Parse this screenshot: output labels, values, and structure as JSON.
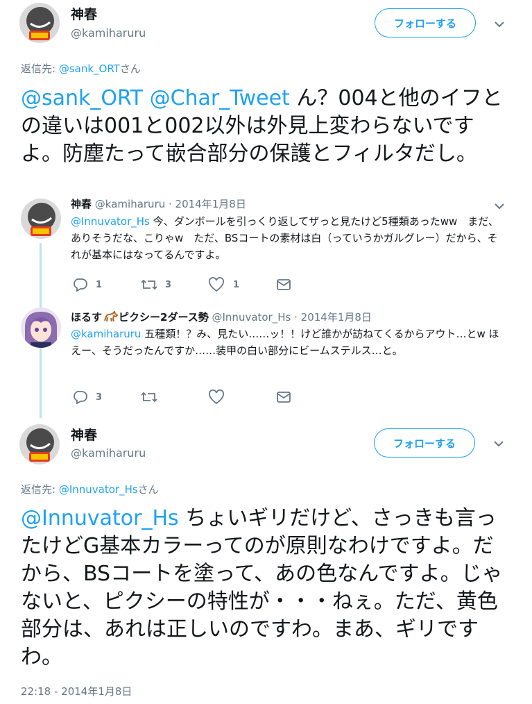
{
  "tweet1": {
    "name": "神春",
    "handle": "@kamiharuru",
    "follow_label": "フォローする",
    "reply_prefix": "返信先: ",
    "reply_to": "@sank_ORT",
    "reply_suffix": "さん",
    "mention1": "@sank_ORT",
    "mention2": "@Char_Tweet",
    "body": " ん？004と他のイフとの違いは001と002以外は外見上変わらないですよ。防塵たって嵌合部分の保護とフィルタだし。"
  },
  "reply1": {
    "name": "神春",
    "handle": "@kamiharuru",
    "date": " · 2014年1月8日",
    "mention": "@Innuvator_Hs",
    "body": " 今、ダンボールを引っくり返してザっと見たけど5種類あったww　まだ、ありそうだな、こりゃw　ただ、BSコートの素材は白（っていうかガルグレー）だから、それが基本にはなってるんですよ。",
    "reply_count": "1",
    "retweet_count": "3",
    "like_count": "1"
  },
  "reply2": {
    "name": "ほるす",
    "name_suffix": "ピクシー2ダース勢",
    "handle": "@Innuvator_Hs",
    "date": " · 2014年1月8日",
    "mention": "@kamiharuru",
    "body": " 五種類！？み、見たい……ッ！！けど誰かが訪ねてくるからアウト…とw ほえー、そうだったんですか……装甲の白い部分にビームステルス…と。",
    "reply_count": "3"
  },
  "tweet2": {
    "name": "神春",
    "handle": "@kamiharuru",
    "follow_label": "フォローする",
    "reply_prefix": "返信先: ",
    "reply_to": "@Innuvator_Hs",
    "reply_suffix": "さん",
    "mention": "@Innuvator_Hs",
    "body": " ちょいギリだけど、さっきも言ったけどG基本カラーってのが原則なわけですよ。だから、BSコートを塗って、あの色なんですよ。じゃないと、ピクシーの特性が・・・ねぇ。ただ、黄色部分は、あれは正しいのですわ。まあ、ギリですわ。",
    "timestamp": "22:18 - 2014年1月8日"
  },
  "colors": {
    "accent": "#1da1f2",
    "secondary_text": "#657786",
    "thread_line": "#bbe4f0"
  }
}
